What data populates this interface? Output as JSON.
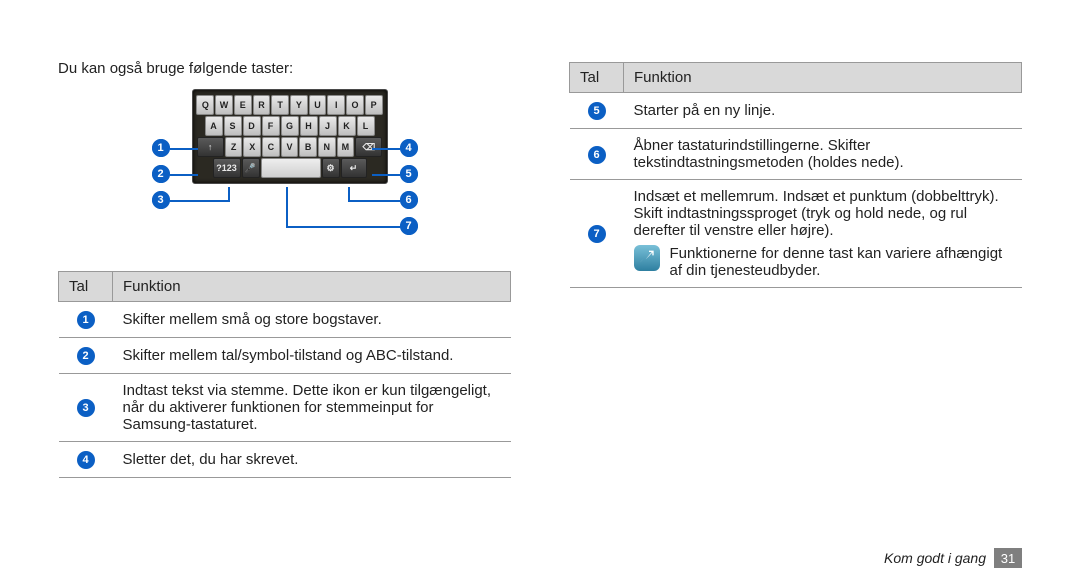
{
  "intro_text": "Du kan også bruge følgende taster:",
  "table_headers": {
    "num": "Tal",
    "func": "Funktion"
  },
  "keyboard": {
    "row1": [
      "Q",
      "W",
      "E",
      "R",
      "T",
      "Y",
      "U",
      "I",
      "O",
      "P"
    ],
    "row2": [
      "A",
      "S",
      "D",
      "F",
      "G",
      "H",
      "J",
      "K",
      "L"
    ],
    "row3_shift": "↑",
    "row3": [
      "Z",
      "X",
      "C",
      "V",
      "B",
      "N",
      "M"
    ],
    "row3_del": "⌫",
    "row4_sym": "?123",
    "row4_mic": "🎤",
    "row4_gear": "⚙",
    "row4_return": "↵"
  },
  "callouts": {
    "1": "1",
    "2": "2",
    "3": "3",
    "4": "4",
    "5": "5",
    "6": "6",
    "7": "7"
  },
  "left_rows": [
    {
      "n": "1",
      "text": "Skifter mellem små og store bogstaver."
    },
    {
      "n": "2",
      "text": "Skifter mellem tal/symbol-tilstand og ABC-tilstand."
    },
    {
      "n": "3",
      "text": "Indtast tekst via stemme. Dette ikon er kun tilgængeligt, når du aktiverer funktionen for stemmeinput for Samsung-tastaturet."
    },
    {
      "n": "4",
      "text": "Sletter det, du har skrevet."
    }
  ],
  "right_rows": [
    {
      "n": "5",
      "text": "Starter på en ny linje."
    },
    {
      "n": "6",
      "text": "Åbner tastaturindstillingerne. Skifter tekstindtastningsmetoden (holdes nede)."
    },
    {
      "n": "7",
      "text": "Indsæt et mellemrum. Indsæt et punktum (dobbelttryk).\nSkift indtastningssproget (tryk og hold nede, og rul derefter til venstre eller højre)."
    }
  ],
  "note_text": "Funktionerne for denne tast kan variere afhængigt af din tjenesteudbyder.",
  "footer_label": "Kom godt i gang",
  "footer_page": "31"
}
